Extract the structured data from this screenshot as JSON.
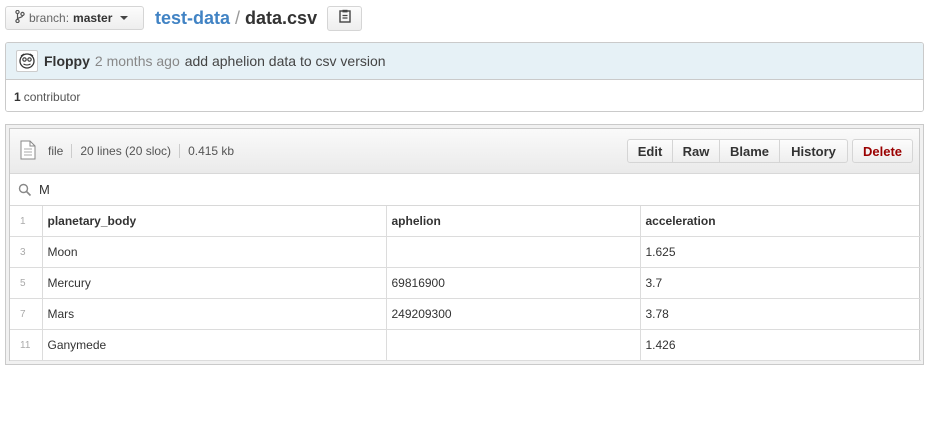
{
  "branch": {
    "label": "branch:",
    "value": "master"
  },
  "breadcrumb": {
    "repo": "test-data",
    "separator": "/",
    "file": "data.csv"
  },
  "commit": {
    "author": "Floppy",
    "age": "2 months ago",
    "message": "add aphelion data to csv version",
    "contributors_count": "1",
    "contributors_label": "contributor"
  },
  "file": {
    "mode": "file",
    "lines": "20 lines (20 sloc)",
    "size": "0.415 kb",
    "buttons": {
      "edit": "Edit",
      "raw": "Raw",
      "blame": "Blame",
      "history": "History",
      "delete": "Delete"
    },
    "search_value": "M"
  },
  "table": {
    "header_line": "1",
    "columns": [
      "planetary_body",
      "aphelion",
      "acceleration"
    ],
    "rows": [
      {
        "line": "3",
        "cells": [
          "Moon",
          "",
          "1.625"
        ]
      },
      {
        "line": "5",
        "cells": [
          "Mercury",
          "69816900",
          "3.7"
        ]
      },
      {
        "line": "7",
        "cells": [
          "Mars",
          "249209300",
          "3.78"
        ]
      },
      {
        "line": "11",
        "cells": [
          "Ganymede",
          "",
          "1.426"
        ]
      }
    ]
  },
  "colors": {
    "link": "#4183c4",
    "delete": "#9a0000",
    "commit_bg": "#e6f1f6"
  },
  "icons": [
    "branch-icon",
    "clipboard-icon",
    "file-icon",
    "search-icon",
    "avatar"
  ]
}
